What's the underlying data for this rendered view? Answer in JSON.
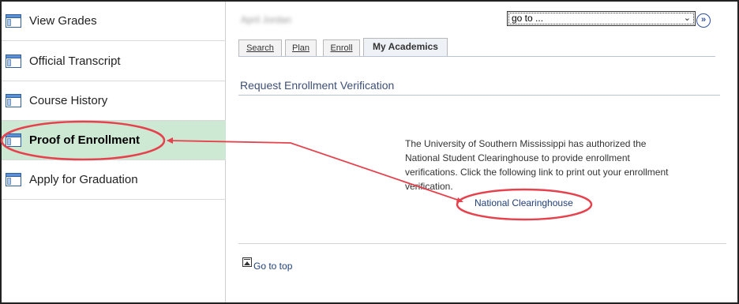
{
  "sidebar": {
    "items": [
      {
        "label": "View Grades",
        "icon": "page-icon"
      },
      {
        "label": "Official Transcript",
        "icon": "page-icon"
      },
      {
        "label": "Course History",
        "icon": "page-icon"
      },
      {
        "label": "Proof of Enrollment",
        "icon": "page-icon",
        "active": true
      },
      {
        "label": "Apply for Graduation",
        "icon": "page-icon"
      }
    ]
  },
  "header": {
    "student_name": "April Jordan",
    "goto_value": "go to ...",
    "go_button": "»"
  },
  "tabs": [
    {
      "label": "Search"
    },
    {
      "label": "Plan"
    },
    {
      "label": "Enroll"
    },
    {
      "label": "My Academics",
      "active": true
    }
  ],
  "main": {
    "section_title": "Request Enrollment Verification",
    "info_text": "The University of Southern Mississippi has authorized the National Student Clearinghouse to provide enrollment verifications. Click the following link to print out your enrollment verification.",
    "link_label": "National Clearinghouse",
    "go_to_top": "Go to top"
  },
  "colors": {
    "active_bg": "#cde8d3",
    "annotation": "#e5424d",
    "link": "#1f3f7a",
    "title": "#3d4f78"
  }
}
